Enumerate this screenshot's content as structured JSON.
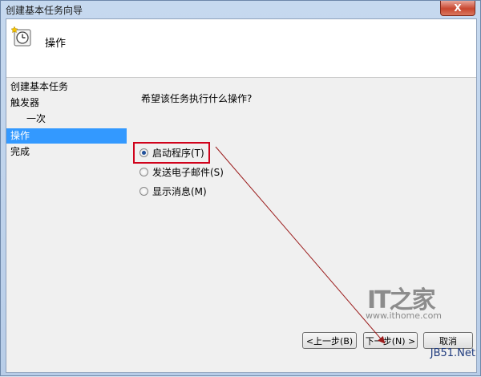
{
  "window": {
    "title": "创建基本任务向导",
    "close_label": "X"
  },
  "header": {
    "title": "操作",
    "icon": "task-clock-icon"
  },
  "nav": {
    "items": [
      {
        "label": "创建基本任务",
        "selected": false
      },
      {
        "label": "触发器",
        "selected": false
      },
      {
        "label": "一次",
        "selected": false
      },
      {
        "label": "操作",
        "selected": true
      },
      {
        "label": "完成",
        "selected": false
      }
    ]
  },
  "main": {
    "prompt": "希望该任务执行什么操作?",
    "options": [
      {
        "label": "启动程序(T)",
        "selected": true
      },
      {
        "label": "发送电子邮件(S)",
        "selected": false
      },
      {
        "label": "显示消息(M)",
        "selected": false
      }
    ]
  },
  "buttons": {
    "back": "<上一步(B)",
    "next": "下一步(N) >",
    "cancel": "取消"
  },
  "watermark": {
    "brand": "IT之家",
    "url": "www.ithome.com",
    "site": "JB51.Net"
  },
  "colors": {
    "selection": "#3399ff",
    "highlight": "#d0021b",
    "arrow": "#9b1c1c"
  }
}
